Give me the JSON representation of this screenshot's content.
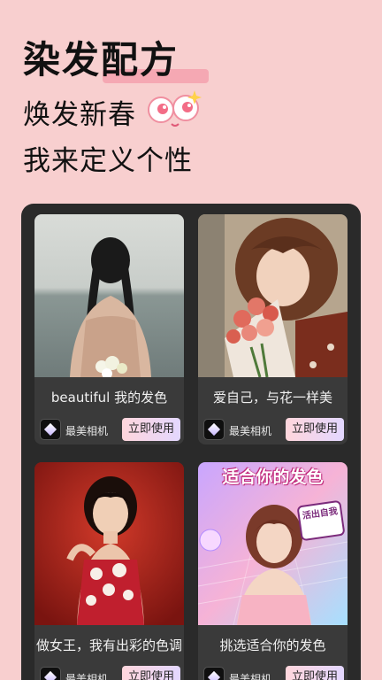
{
  "hero": {
    "title": "染发配方",
    "line1": "焕发新春",
    "line2": "我来定义个性"
  },
  "cards": [
    {
      "caption": "beautiful 我的发色",
      "brand": "最美相机",
      "button": "立即使用"
    },
    {
      "caption": "爱自己，与花一样美",
      "brand": "最美相机",
      "button": "立即使用"
    },
    {
      "caption": "做女王，我有出彩的色调",
      "brand": "最美相机",
      "button": "立即使用"
    },
    {
      "caption": "挑选适合你的发色",
      "brand": "最美相机",
      "button": "立即使用",
      "overlay_title": "适合你的发色",
      "overlay_badge": "活出自我"
    }
  ],
  "colors": {
    "background": "#f8cfcf",
    "panel": "#2a2a2a",
    "card": "#3a3a3a"
  }
}
